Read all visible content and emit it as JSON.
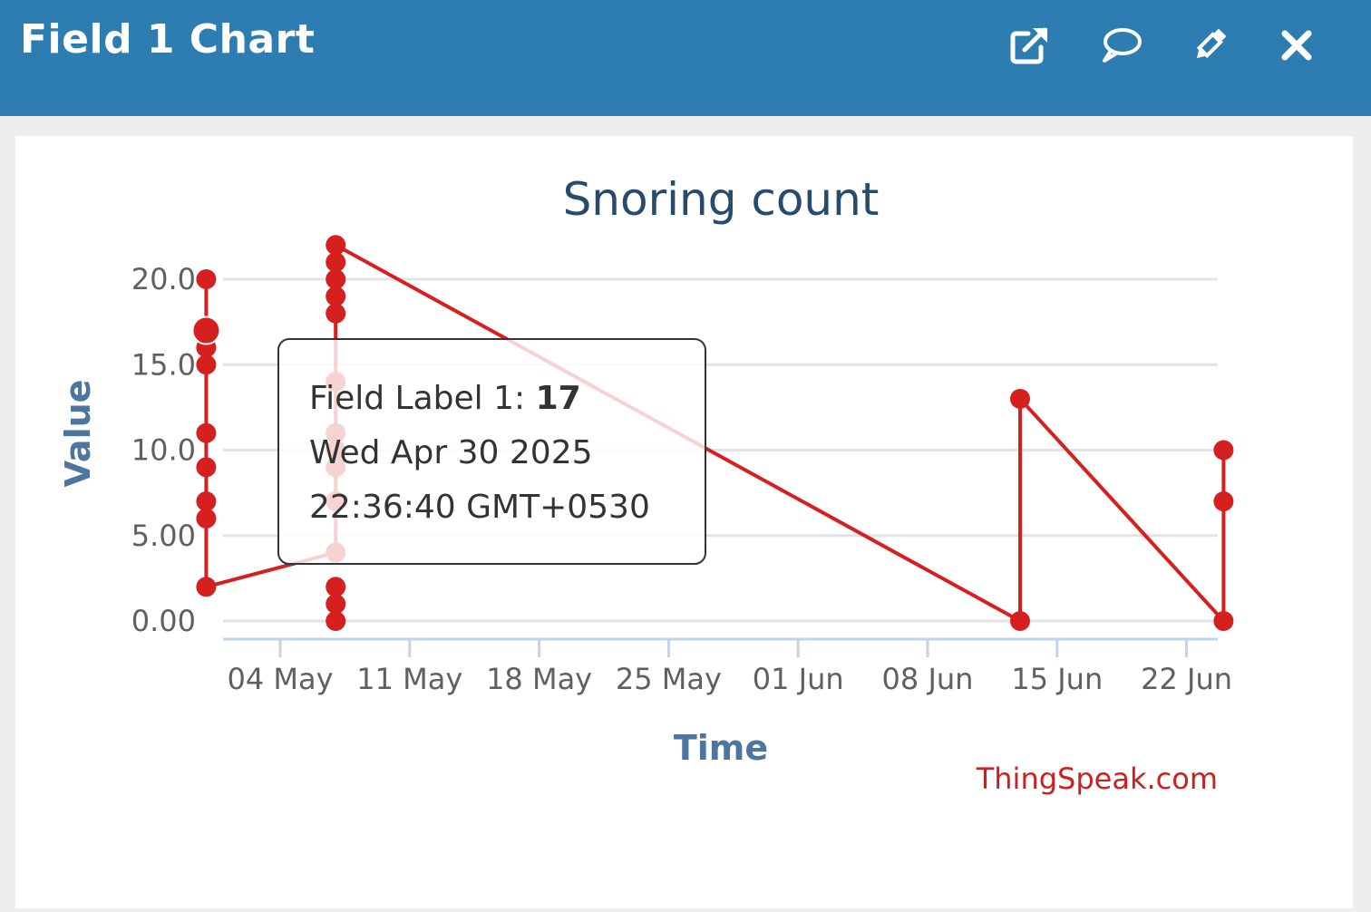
{
  "window": {
    "title": "Field 1 Chart",
    "icons": [
      "external-link-icon",
      "comment-icon",
      "pencil-icon",
      "close-icon"
    ]
  },
  "colors": {
    "header_bg": "#2e7db2",
    "series": "#d62020",
    "title": "#274b6d",
    "axis_title": "#4d759e",
    "credit": "#cc1f1f"
  },
  "chart_data": {
    "type": "line",
    "title": "Snoring count",
    "xlabel": "Time",
    "ylabel": "Value",
    "ylim": [
      0,
      20
    ],
    "yticks": [
      "0.00",
      "5.00",
      "10.0",
      "15.0",
      "20.0"
    ],
    "xticks": [
      {
        "label": "04 May",
        "date": "2025-05-04"
      },
      {
        "label": "11 May",
        "date": "2025-05-11"
      },
      {
        "label": "18 May",
        "date": "2025-05-18"
      },
      {
        "label": "25 May",
        "date": "2025-05-25"
      },
      {
        "label": "01 Jun",
        "date": "2025-06-01"
      },
      {
        "label": "08 Jun",
        "date": "2025-06-08"
      },
      {
        "label": "15 Jun",
        "date": "2025-06-15"
      },
      {
        "label": "22 Jun",
        "date": "2025-06-22"
      }
    ],
    "grid": true,
    "legend": "none",
    "series": [
      {
        "points": [
          {
            "x": "2025-04-30",
            "y": 20
          },
          {
            "x": "2025-04-30",
            "y": 16
          },
          {
            "x": "2025-04-30",
            "y": 17
          },
          {
            "x": "2025-04-30",
            "y": 15
          },
          {
            "x": "2025-04-30",
            "y": 11
          },
          {
            "x": "2025-04-30",
            "y": 9
          },
          {
            "x": "2025-04-30",
            "y": 7
          },
          {
            "x": "2025-04-30",
            "y": 6
          },
          {
            "x": "2025-04-30",
            "y": 2
          },
          {
            "x": "2025-05-07",
            "y": 4
          },
          {
            "x": "2025-05-07",
            "y": 7
          },
          {
            "x": "2025-05-07",
            "y": 9
          },
          {
            "x": "2025-05-07",
            "y": 10
          },
          {
            "x": "2025-05-07",
            "y": 11
          },
          {
            "x": "2025-05-07",
            "y": 14
          },
          {
            "x": "2025-05-07",
            "y": 18
          },
          {
            "x": "2025-05-07",
            "y": 19
          },
          {
            "x": "2025-05-07",
            "y": 20
          },
          {
            "x": "2025-05-07",
            "y": 21
          },
          {
            "x": "2025-05-07",
            "y": 22
          },
          {
            "x": "2025-05-07",
            "y": 2
          },
          {
            "x": "2025-05-07",
            "y": 1
          },
          {
            "x": "2025-05-07",
            "y": 0
          },
          {
            "x": "2025-06-13",
            "y": 0
          },
          {
            "x": "2025-06-13",
            "y": 13
          },
          {
            "x": "2025-06-24",
            "y": 0
          },
          {
            "x": "2025-06-24",
            "y": 7
          },
          {
            "x": "2025-06-24",
            "y": 10
          }
        ],
        "line_path": [
          {
            "x": "2025-04-30",
            "y": 20
          },
          {
            "x": "2025-04-30",
            "y": 2
          },
          {
            "x": "2025-05-07",
            "y": 4
          },
          {
            "x": "2025-05-07",
            "y": 22
          },
          {
            "x": "2025-06-13",
            "y": 0
          },
          {
            "x": "2025-06-13",
            "y": 13
          },
          {
            "x": "2025-06-24",
            "y": 0
          },
          {
            "x": "2025-06-24",
            "y": 10
          }
        ]
      }
    ],
    "highlighted_point": {
      "x": "2025-04-30",
      "y": 17
    },
    "tooltip": {
      "label": "Field Label 1: ",
      "value": "17",
      "line2": "Wed Apr 30 2025",
      "line3": "22:36:40 GMT+0530"
    },
    "credit": "ThingSpeak.com"
  }
}
